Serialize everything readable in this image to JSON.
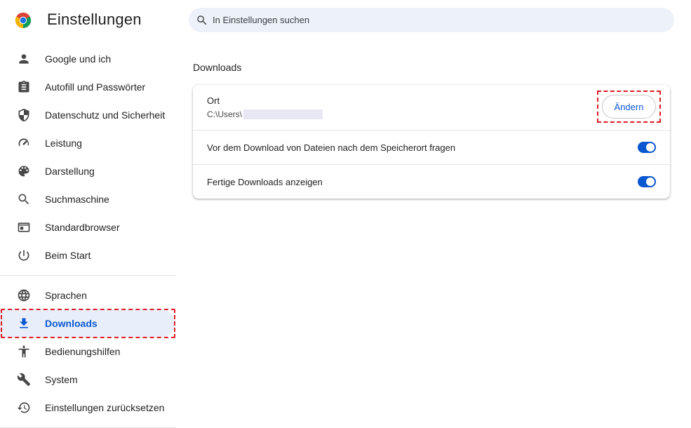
{
  "header": {
    "title": "Einstellungen",
    "search_placeholder": "In Einstellungen suchen"
  },
  "sidebar": {
    "group1": [
      {
        "label": "Google und ich",
        "icon": "person-icon"
      },
      {
        "label": "Autofill und Passwörter",
        "icon": "clipboard-icon"
      },
      {
        "label": "Datenschutz und Sicherheit",
        "icon": "shield-icon"
      },
      {
        "label": "Leistung",
        "icon": "speedometer-icon"
      },
      {
        "label": "Darstellung",
        "icon": "palette-icon"
      },
      {
        "label": "Suchmaschine",
        "icon": "search-icon"
      },
      {
        "label": "Standardbrowser",
        "icon": "browser-window-icon"
      },
      {
        "label": "Beim Start",
        "icon": "power-icon"
      }
    ],
    "group2": [
      {
        "label": "Sprachen",
        "icon": "globe-icon"
      },
      {
        "label": "Downloads",
        "icon": "download-icon",
        "active": true
      },
      {
        "label": "Bedienungshilfen",
        "icon": "accessibility-icon"
      },
      {
        "label": "System",
        "icon": "wrench-icon"
      },
      {
        "label": "Einstellungen zurücksetzen",
        "icon": "reset-icon"
      }
    ]
  },
  "main": {
    "section_title": "Downloads",
    "location": {
      "label": "Ort",
      "path": "C:\\Users\\",
      "change_label": "Ändern"
    },
    "ask_location": {
      "label": "Vor dem Download von Dateien nach dem Speicherort fragen",
      "enabled": true
    },
    "show_downloads": {
      "label": "Fertige Downloads anzeigen",
      "enabled": true
    }
  },
  "colors": {
    "accent": "#0b57d0",
    "active_bg": "#e8effb",
    "search_bg": "#edf2fa",
    "highlight": "#e01b24"
  }
}
